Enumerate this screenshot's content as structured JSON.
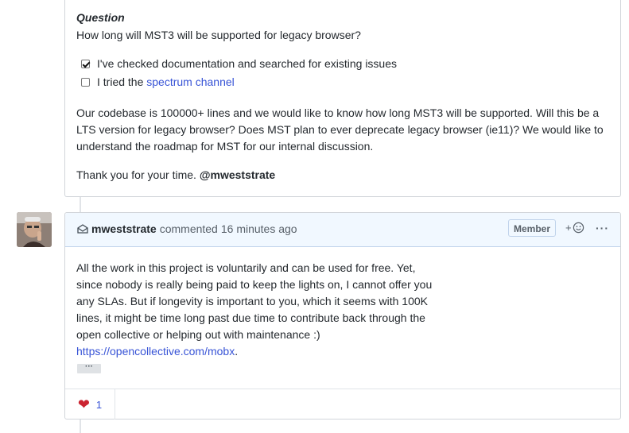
{
  "question": {
    "title": "Question",
    "body": "How long will MST3 will be supported for legacy browser?"
  },
  "tasks": [
    {
      "label": "I've checked documentation and searched for existing issues",
      "checked": true
    },
    {
      "label_prefix": "I tried the ",
      "link_text": "spectrum channel",
      "checked": false
    }
  ],
  "paragraph": [
    "Our codebase is 100000+ lines and we would like to know how long MST3 will be supported. Will this be a",
    "LTS version for legacy browser? Does MST plan to ever deprecate legacy browser (ie11)? We would like to",
    "understand the roadmap for MST for our internal discussion."
  ],
  "thanks": {
    "text": "Thank you for your time. ",
    "mention": "@mweststrate"
  },
  "comment": {
    "author": "mweststrate",
    "action": "commented",
    "time": "16 minutes ago",
    "badge": "Member",
    "add_reaction": "+",
    "more": "···",
    "body_lines": [
      "All the work in this project is voluntarily and can be used for free. Yet,",
      "since nobody is really being paid to keep the lights on, I cannot offer you",
      "any SLAs. But if longevity is important to you, which it seems with 100K",
      "lines, it might be time long past due time to contribute back through the",
      "open collective or helping out with maintenance :)"
    ],
    "link": "https://opencollective.com/mobx",
    "link_suffix": ".",
    "expand": "···",
    "reaction_count": "1"
  }
}
